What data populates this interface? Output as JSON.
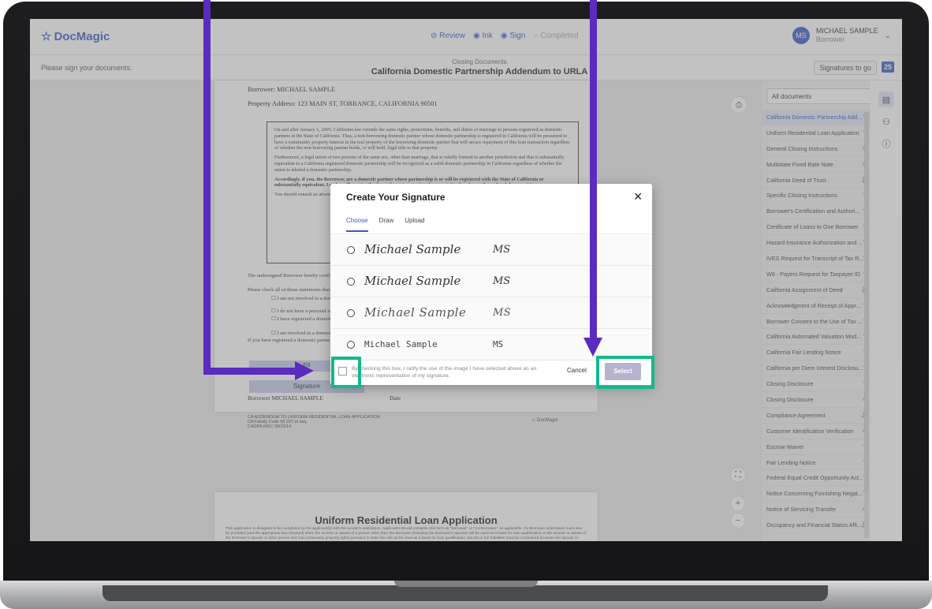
{
  "app": {
    "logo": "DocMagic",
    "steps": [
      "Review",
      "Ink",
      "Sign",
      "Completed"
    ],
    "user": {
      "initials": "MS",
      "name": "MICHAEL SAMPLE",
      "role": "Borrower"
    }
  },
  "subheader": {
    "prompt": "Please sign your documents.",
    "doc_group": "Closing Documents",
    "doc_title": "California Domestic Partnership Addendum to URLA",
    "signatures_label": "Signatures to go",
    "signatures_count": "25"
  },
  "document": {
    "borrower_line": "Borrower:  MICHAEL SAMPLE",
    "property_line": "Property Address:  123 MAIN ST, TORRANCE, CALIFORNIA 90501",
    "para1": "On and after January 1, 2005, California law extends the same rights, protections, benefits, and duties of marriage to persons registered as domestic partners in the State of California. Thus, a non-borrowing domestic partner whose domestic partnership is registered in California will be presumed to have a community property interest in the real property of the borrowing domestic partner that will secure repayment of this loan transaction regardless of whether the non-borrowing partner holds, or will hold, legal title to that property.",
    "para2": "Furthermore, a legal union of two persons of the same sex, other than marriage, that is validly formed in another jurisdiction and that is substantially equivalent to a California registered domestic partnership will be recognized as a valid domestic partnership in California regardless of whether the union is labeled a domestic partnership.",
    "para3": "Accordingly, if you, the Borrower, are a domestic partner whose partnership is or will be registered with the State of California or substantially equivalent, Lender will require the domestic partner to sign documents (and perhaps other related documents).",
    "para4": "You should consult an attorney for specific legal advice regarding the effects of domestic partnership.",
    "undersigned": "The undersigned Borrower hereby certifies to Lender and its attorneys, insurers, servicers, successors and assigns:",
    "check_all": "Please check all of those statements that apply:",
    "checks": [
      "I am not involved in a domestic partnership or civil union.",
      "I do not have a personal relationship.",
      "I have registered a domestic partnership, a Certificate of Domestic Partnership.",
      "I am involved in a domestic partnership."
    ],
    "registered_line": "If you have registered a domestic partnership in a jurisdiction, please provide the",
    "fill_label": "Fill",
    "signature_label": "Signature",
    "sign_borrower": "Borrower  MICHAEL SAMPLE",
    "sign_date": "Date",
    "footer_line1": "CA ADDENDUM TO UNIFORM RESIDENTIAL LOAN APPLICATION",
    "footer_line2": "CA Family Code §§ 297 et seq.",
    "footer_line3": "CADPA.MSC  09/29/14",
    "footer_logo": "DocMagic",
    "page2_title": "Uniform Residential Loan Application",
    "page2_fine": "This application is designed to be completed by the applicant(s) with the Lender's assistance. Applicants should complete this form as \"Borrower\" or \"Co-Borrower,\" as applicable. Co-Borrower information must also be provided (and the appropriate box checked) when the income or assets of a person other than the Borrower (including the Borrower's spouse) will be used as a basis for loan qualification or the income or assets of the Borrower's spouse or other person who has community property rights pursuant to state law will not be used as a basis for loan qualification, but his or her liabilities must be considered because the spouse or other person has community property rights pursuant to applicable law and Borrower resides in a community property"
  },
  "sidebar": {
    "filter": "All documents",
    "documents": [
      {
        "name": "California Domestic Partnership Add...",
        "status": "pen-icon",
        "active": true
      },
      {
        "name": "Uniform Residential Loan Application",
        "status": "pen-icon"
      },
      {
        "name": "General Closing Instructions",
        "status": "eye-icon"
      },
      {
        "name": "Multistate Fixed Rate Note",
        "status": "eye-icon"
      },
      {
        "name": "California Deed of Trust",
        "status": "stamp-icon"
      },
      {
        "name": "Specific Closing Instructions",
        "status": "pen-icon"
      },
      {
        "name": "Borrower's Certification and Authori...",
        "status": "pen-icon"
      },
      {
        "name": "Certificate of Loans to One Borrower",
        "status": "pen-icon"
      },
      {
        "name": "Hazard Insurance Authorization and ...",
        "status": "pen-icon"
      },
      {
        "name": "IVES Request for Transcript of Tax R...",
        "status": "pen-icon"
      },
      {
        "name": "W9 - Payers Request for Taxpayer ID",
        "status": "pen-icon"
      },
      {
        "name": "California Assignment of Deed",
        "status": "stamp-icon"
      },
      {
        "name": "Acknowledgment of Receipt of Appr...",
        "status": "pen-icon"
      },
      {
        "name": "Borrower Consent to the Use of Tax ...",
        "status": "pen-icon"
      },
      {
        "name": "California Automated Valuation Mod...",
        "status": "pen-icon"
      },
      {
        "name": "California Fair Lending Notice",
        "status": "pen-icon"
      },
      {
        "name": "California per Diem Interest Disclosu...",
        "status": "pen-icon"
      },
      {
        "name": "Closing Disclosure",
        "status": "pen-icon"
      },
      {
        "name": "Closing Disclosure",
        "status": "eye-icon"
      },
      {
        "name": "Compliance Agreement",
        "status": "stamp-icon"
      },
      {
        "name": "Customer Identification Verification",
        "status": "eye-icon"
      },
      {
        "name": "Escrow Waiver",
        "status": "pen-icon"
      },
      {
        "name": "Fair Lending Notice",
        "status": "pen-icon"
      },
      {
        "name": "Federal Equal Credit Opportunity Act...",
        "status": "pen-icon"
      },
      {
        "name": "Notice Concerning Furnishing Negat...",
        "status": "pen-icon"
      },
      {
        "name": "Notice of Servicing Transfer",
        "status": "eye-icon"
      },
      {
        "name": "Occupancy and Financial Status Affi...",
        "status": "stamp-icon"
      }
    ]
  },
  "modal": {
    "title": "Create Your Signature",
    "close": "✕",
    "tabs": [
      "Choose",
      "Draw",
      "Upload"
    ],
    "options": [
      {
        "name": "Michael Sample",
        "initials": "MS"
      },
      {
        "name": "Michael Sample",
        "initials": "MS"
      },
      {
        "name": "Michael Sample",
        "initials": "MS"
      },
      {
        "name": "Michael Sample",
        "initials": "MS"
      }
    ],
    "consent": "By checking this box, I ratify the use of the image I have selected above as an electronic representation of my signature.",
    "cancel": "Cancel",
    "select": "Select"
  },
  "colors": {
    "brand": "#3a59c7",
    "highlight": "#13b98a",
    "arrow": "#5b2bbf",
    "select_button": "#b9b2cf"
  }
}
